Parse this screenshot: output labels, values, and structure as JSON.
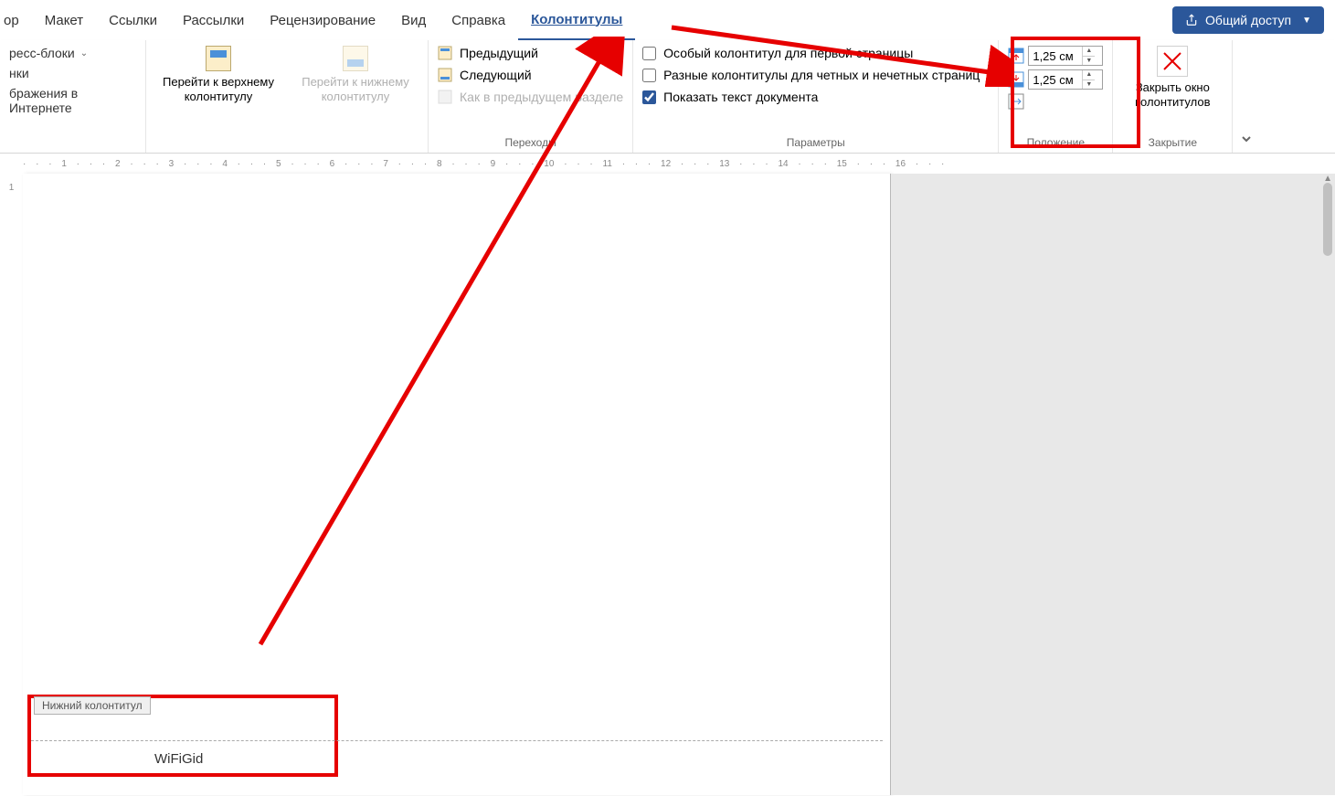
{
  "tabs": {
    "partial1": "ор",
    "layout": "Макет",
    "links": "Ссылки",
    "mailings": "Рассылки",
    "review": "Рецензирование",
    "view": "Вид",
    "help": "Справка",
    "headers_footers": "Колонтитулы"
  },
  "share": {
    "label": "Общий доступ"
  },
  "group1": {
    "express": "ресс-блоки",
    "pictures": "нки",
    "webimages": "бражения в Интернете"
  },
  "nav": {
    "goto_top": "Перейти к верхнему колонтитулу",
    "goto_bottom": "Перейти к нижнему колонтитулу",
    "group_label": "Переходы"
  },
  "transitions": {
    "prev": "Предыдущий",
    "next": "Следующий",
    "same": "Как в предыдущем разделе"
  },
  "params": {
    "first_page": "Особый колонтитул для первой страницы",
    "odd_even": "Разные колонтитулы для четных и нечетных страниц",
    "show_text": "Показать текст документа",
    "group_label": "Параметры"
  },
  "position": {
    "header_val": "1,25 см",
    "footer_val": "1,25 см",
    "group_label": "Положение"
  },
  "close": {
    "label": "Закрыть окно колонтитулов",
    "group_label": "Закрытие"
  },
  "ruler": {
    "marks": "· · · 1 · · · 2 · · · 3 · · · 4 · · · 5 · · · 6 · · · 7 · · · 8 · · · 9 · · · 10 · · · 11 · · · 12 · · · 13 · · · 14 · · · 15 · · · 16 · · ·",
    "v1": "1"
  },
  "footer": {
    "tag": "Нижний колонтитул",
    "text": "WiFiGid"
  }
}
